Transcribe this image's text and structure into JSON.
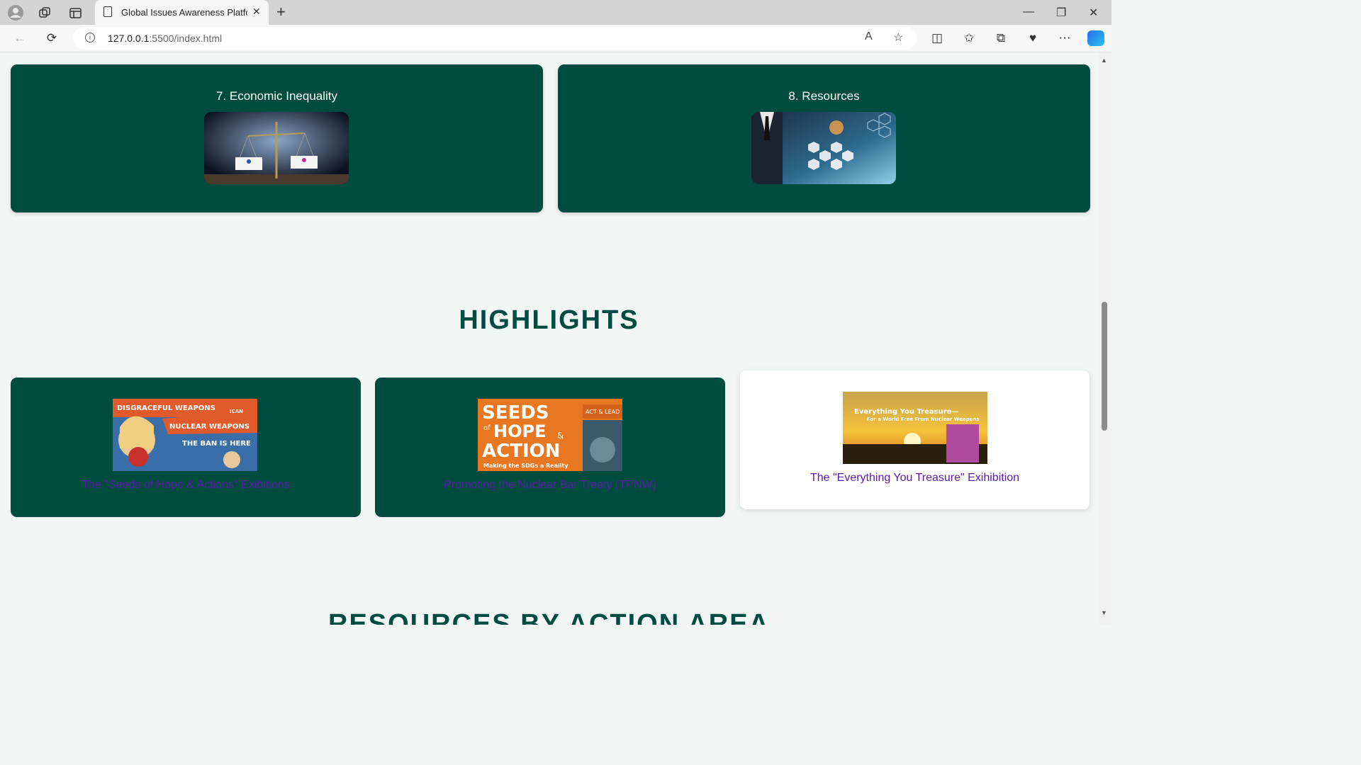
{
  "browser": {
    "tab_title": "Global Issues Awareness Platform",
    "url_host": "127.0.0.1",
    "url_rest": ":5500/index.html"
  },
  "issues": [
    {
      "title": "7. Economic Inequality",
      "image": "scales-men-women-image"
    },
    {
      "title": "8. Resources",
      "image": "supply-chain-network-image"
    }
  ],
  "highlights": {
    "heading": "HIGHLIGHTS",
    "items": [
      {
        "caption": "The \"Seeds of Hope & Actions\" Exibitions",
        "image_text": [
          "DISGRACEFUL WEAPONS",
          "NUCLEAR WEAPONS",
          "THE BAN IS HERE",
          "ICAN"
        ]
      },
      {
        "caption": "Promoting the Nuclear Bar Treaty (TPNW)",
        "image_text": [
          "SEEDS",
          "of",
          "HOPE",
          "&",
          "ACTION",
          "Making the SDGs a Reality",
          "ACT & LEAD"
        ]
      },
      {
        "caption": "The \"Everything You Treasure\" Exihibition",
        "image_text": [
          "Everything You Treasure—",
          "For a World Free From Nuclear Weapons"
        ]
      }
    ]
  },
  "next_section_heading": "RESOURCES BY ACTION AREA"
}
